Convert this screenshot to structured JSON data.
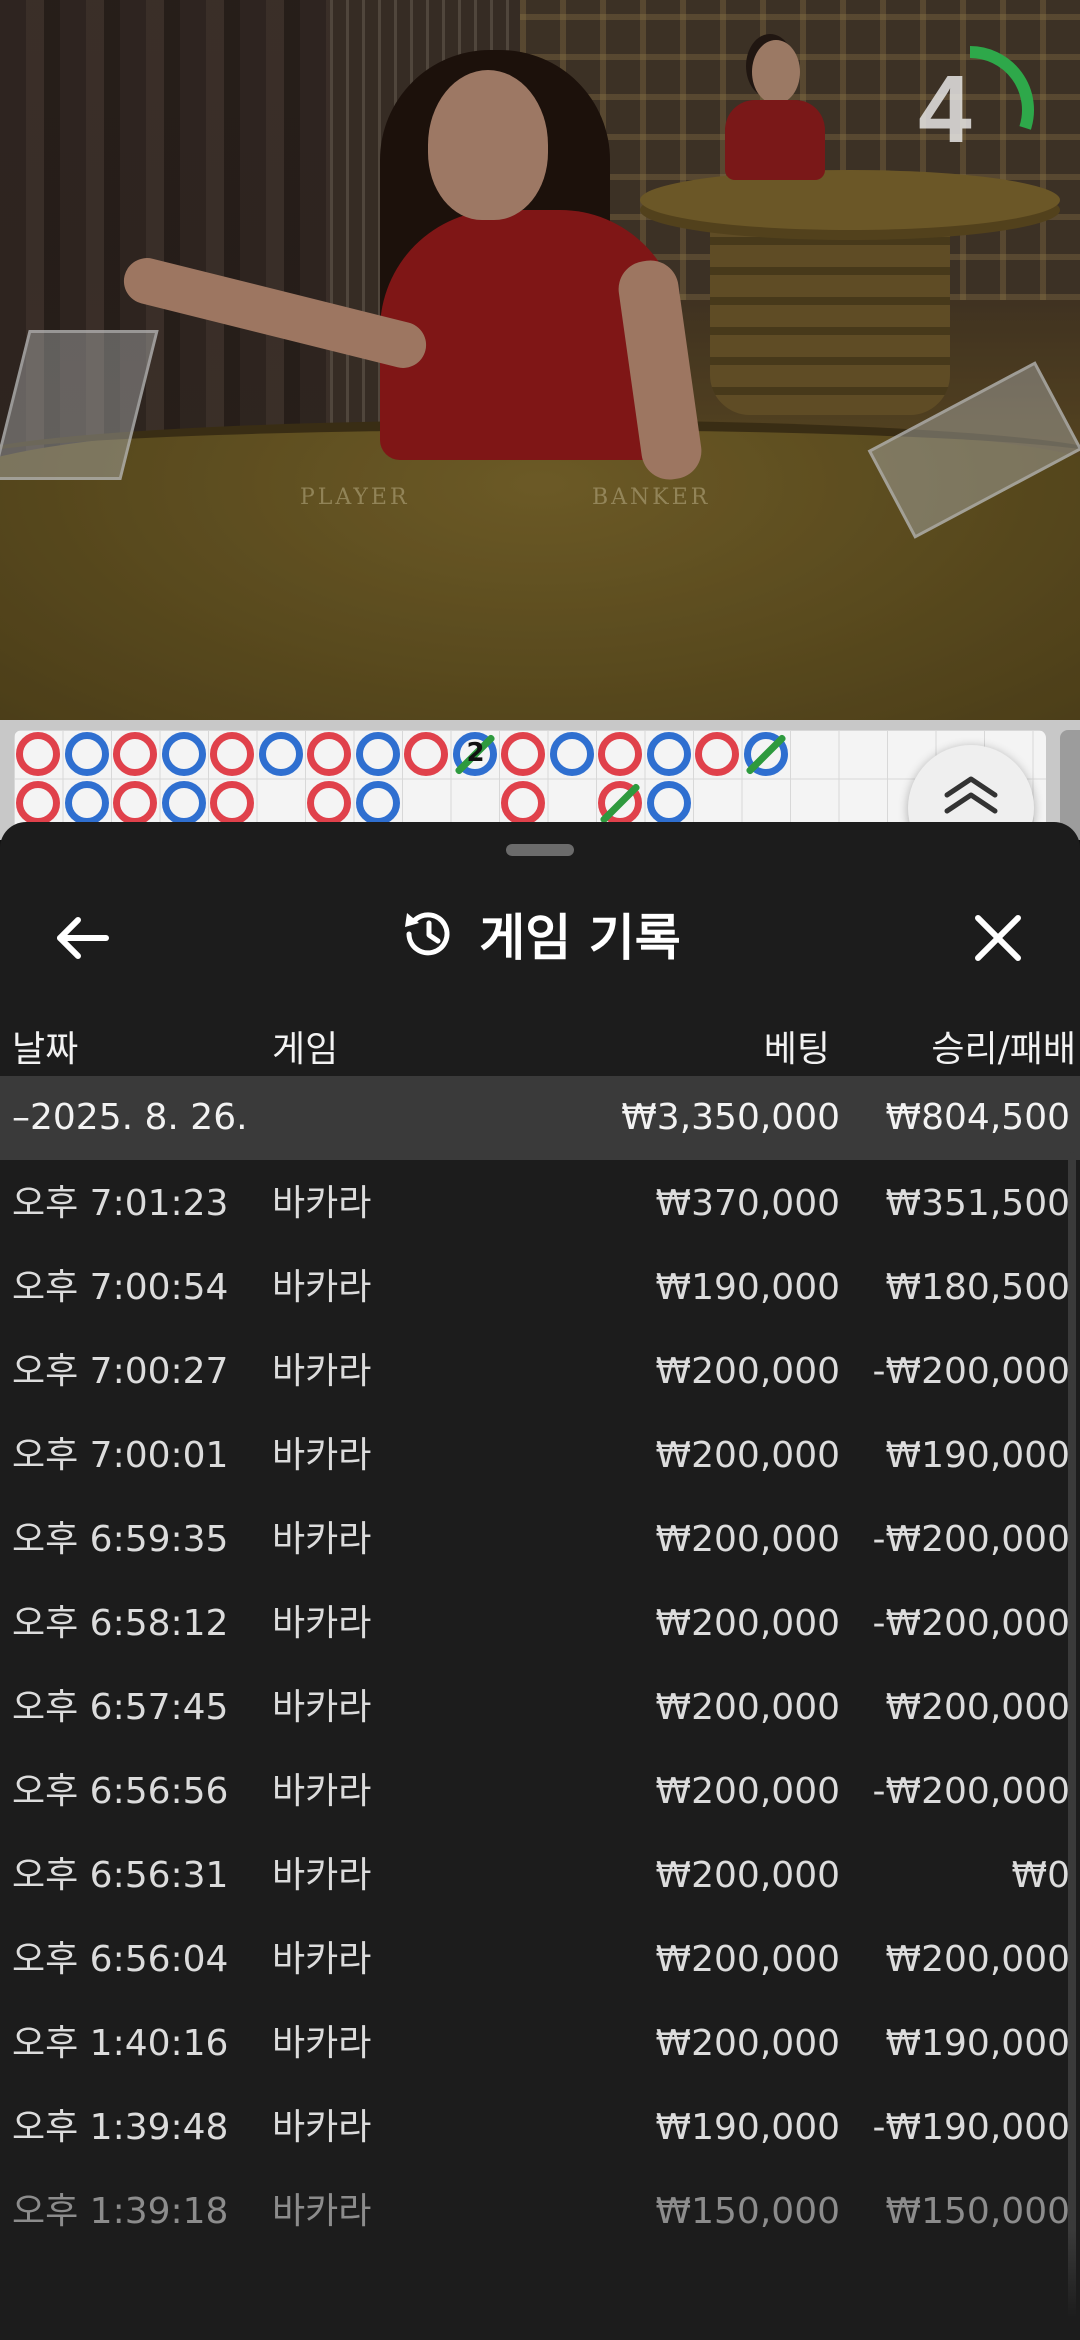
{
  "timer": {
    "value": "4",
    "progress_fraction": 0.3
  },
  "felt": {
    "player_label": "PLAYER",
    "banker_label": "BANKER"
  },
  "roadmap": {
    "colors": {
      "banker": "#e0414b",
      "player": "#2f6fd0",
      "tie": "#2e9a3e"
    },
    "counter": "2"
  },
  "sheet": {
    "title": "게임 기록",
    "icons": {
      "back": "arrow-left-icon",
      "history": "history-clock-icon",
      "close": "close-icon"
    },
    "columns": {
      "date": "날짜",
      "game": "게임",
      "bet": "베팅",
      "win_loss": "승리/패배"
    },
    "day_summary": {
      "date": "–2025. 8. 26.",
      "bet": "₩3,350,000",
      "win_loss": "₩804,500"
    },
    "rows": [
      {
        "time": "오후 7:01:23",
        "game": "바카라",
        "bet": "₩370,000",
        "win_loss": "₩351,500"
      },
      {
        "time": "오후 7:00:54",
        "game": "바카라",
        "bet": "₩190,000",
        "win_loss": "₩180,500"
      },
      {
        "time": "오후 7:00:27",
        "game": "바카라",
        "bet": "₩200,000",
        "win_loss": "-₩200,000"
      },
      {
        "time": "오후 7:00:01",
        "game": "바카라",
        "bet": "₩200,000",
        "win_loss": "₩190,000"
      },
      {
        "time": "오후 6:59:35",
        "game": "바카라",
        "bet": "₩200,000",
        "win_loss": "-₩200,000"
      },
      {
        "time": "오후 6:58:12",
        "game": "바카라",
        "bet": "₩200,000",
        "win_loss": "-₩200,000"
      },
      {
        "time": "오후 6:57:45",
        "game": "바카라",
        "bet": "₩200,000",
        "win_loss": "₩200,000"
      },
      {
        "time": "오후 6:56:56",
        "game": "바카라",
        "bet": "₩200,000",
        "win_loss": "-₩200,000"
      },
      {
        "time": "오후 6:56:31",
        "game": "바카라",
        "bet": "₩200,000",
        "win_loss": "₩0"
      },
      {
        "time": "오후 6:56:04",
        "game": "바카라",
        "bet": "₩200,000",
        "win_loss": "₩200,000"
      },
      {
        "time": "오후 1:40:16",
        "game": "바카라",
        "bet": "₩200,000",
        "win_loss": "₩190,000"
      },
      {
        "time": "오후 1:39:48",
        "game": "바카라",
        "bet": "₩190,000",
        "win_loss": "-₩190,000"
      },
      {
        "time": "오후 1:39:18",
        "game": "바카라",
        "bet": "₩150,000",
        "win_loss": "₩150,000"
      }
    ]
  }
}
